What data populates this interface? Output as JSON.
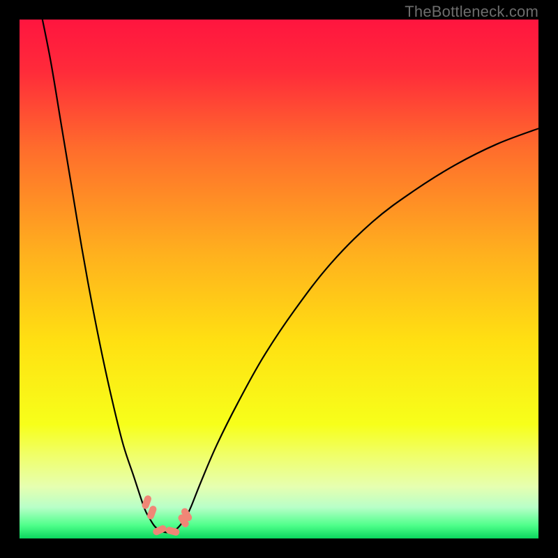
{
  "watermark": "TheBottleneck.com",
  "chart_data": {
    "type": "line",
    "title": "",
    "xlabel": "",
    "ylabel": "",
    "xlim": [
      0,
      100
    ],
    "ylim": [
      0,
      100
    ],
    "grid": false,
    "legend": false,
    "background": {
      "type": "vertical-gradient",
      "stops": [
        {
          "pos": 0.0,
          "color": "#ff153f"
        },
        {
          "pos": 0.1,
          "color": "#ff2b3a"
        },
        {
          "pos": 0.25,
          "color": "#ff6d2c"
        },
        {
          "pos": 0.45,
          "color": "#ffb01e"
        },
        {
          "pos": 0.62,
          "color": "#ffe012"
        },
        {
          "pos": 0.78,
          "color": "#f7ff1a"
        },
        {
          "pos": 0.84,
          "color": "#f0ff6a"
        },
        {
          "pos": 0.9,
          "color": "#e6ffb0"
        },
        {
          "pos": 0.94,
          "color": "#b8ffc8"
        },
        {
          "pos": 0.975,
          "color": "#4eff8a"
        },
        {
          "pos": 1.0,
          "color": "#0bd65e"
        }
      ]
    },
    "series": [
      {
        "name": "bottleneck-curve",
        "stroke": "#000000",
        "points": [
          {
            "x": 4,
            "y": 102
          },
          {
            "x": 6,
            "y": 92
          },
          {
            "x": 8,
            "y": 80
          },
          {
            "x": 10,
            "y": 68
          },
          {
            "x": 12,
            "y": 56
          },
          {
            "x": 14,
            "y": 45
          },
          {
            "x": 16,
            "y": 35
          },
          {
            "x": 18,
            "y": 26
          },
          {
            "x": 20,
            "y": 18
          },
          {
            "x": 22,
            "y": 12
          },
          {
            "x": 24,
            "y": 6
          },
          {
            "x": 25,
            "y": 4
          },
          {
            "x": 26,
            "y": 2.4
          },
          {
            "x": 27,
            "y": 1.6
          },
          {
            "x": 28,
            "y": 1.2
          },
          {
            "x": 29,
            "y": 1.2
          },
          {
            "x": 30,
            "y": 1.6
          },
          {
            "x": 31,
            "y": 2.6
          },
          {
            "x": 32,
            "y": 4
          },
          {
            "x": 33,
            "y": 6
          },
          {
            "x": 35,
            "y": 11
          },
          {
            "x": 38,
            "y": 18
          },
          {
            "x": 42,
            "y": 26
          },
          {
            "x": 47,
            "y": 35
          },
          {
            "x": 53,
            "y": 44
          },
          {
            "x": 60,
            "y": 53
          },
          {
            "x": 68,
            "y": 61
          },
          {
            "x": 76,
            "y": 67
          },
          {
            "x": 84,
            "y": 72
          },
          {
            "x": 92,
            "y": 76
          },
          {
            "x": 100,
            "y": 79
          }
        ]
      }
    ],
    "markers": [
      {
        "x": 24.5,
        "y": 7.0,
        "angle": -70,
        "color": "#f08676"
      },
      {
        "x": 25.5,
        "y": 5.0,
        "angle": -70,
        "color": "#f08676"
      },
      {
        "x": 27.0,
        "y": 1.6,
        "angle": -25,
        "color": "#f08676"
      },
      {
        "x": 29.5,
        "y": 1.4,
        "angle": 15,
        "color": "#f08676"
      },
      {
        "x": 31.6,
        "y": 3.4,
        "angle": 58,
        "color": "#f08676"
      },
      {
        "x": 32.2,
        "y": 4.6,
        "angle": 58,
        "color": "#f08676"
      }
    ]
  }
}
